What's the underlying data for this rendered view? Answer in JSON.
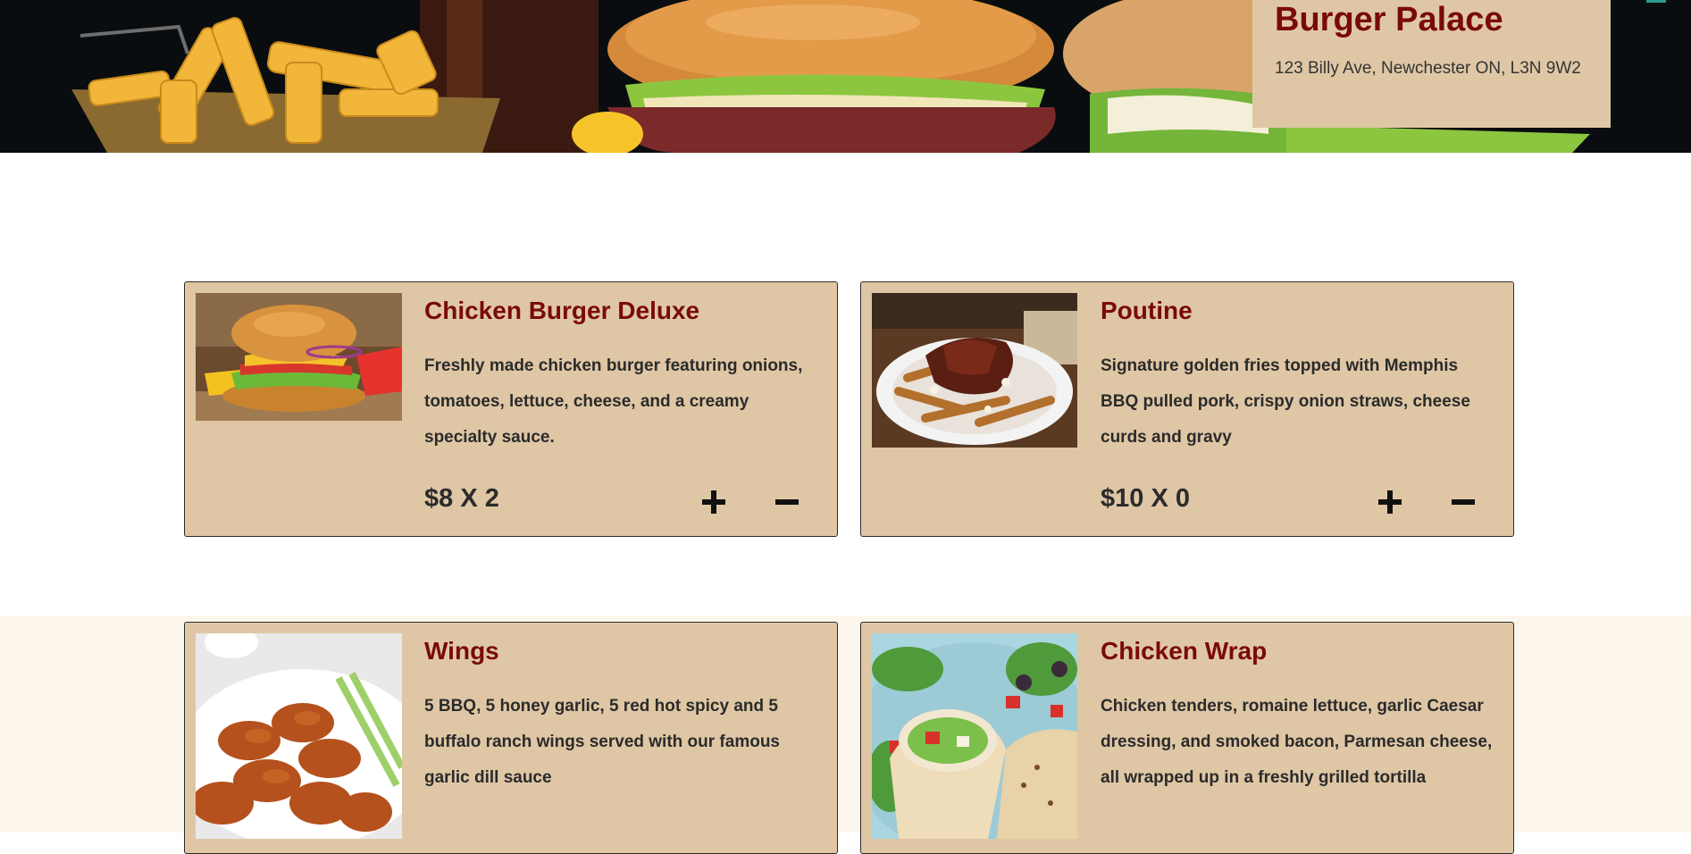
{
  "restaurant": {
    "name": "Burger Palace",
    "address": "123 Billy Ave, Newchester ON, L3N 9W2"
  },
  "menu": [
    {
      "title": "Chicken Burger Deluxe",
      "description": "Freshly made chicken burger featuring onions, tomatoes, lettuce, cheese, and a creamy specialty sauce.",
      "price_line": "$8 X 2",
      "price": 8,
      "quantity": 2,
      "image": "chicken-burger-photo"
    },
    {
      "title": "Poutine",
      "description": "Signature golden fries topped with Memphis BBQ pulled pork, crispy onion straws, cheese curds and gravy",
      "price_line": "$10 X 0",
      "price": 10,
      "quantity": 0,
      "image": "poutine-photo"
    },
    {
      "title": "Wings",
      "description": "5 BBQ, 5 honey garlic, 5 red hot spicy and 5 buffalo ranch wings served with our famous garlic dill sauce",
      "image": "wings-photo"
    },
    {
      "title": "Chicken Wrap",
      "description": "Chicken tenders, romaine lettuce, garlic Caesar dressing, and smoked bacon, Parmesan cheese, all wrapped up in a freshly grilled tortilla",
      "image": "chicken-wrap-photo"
    }
  ],
  "icons": {
    "add": "plus-icon",
    "remove": "minus-icon"
  },
  "colors": {
    "card_background": "#dfc7a5",
    "title_red": "#7a0a0a",
    "text_dark": "#2b2b2b",
    "band_cream": "#fdf6ec",
    "hero_dark": "#0a0d10"
  }
}
